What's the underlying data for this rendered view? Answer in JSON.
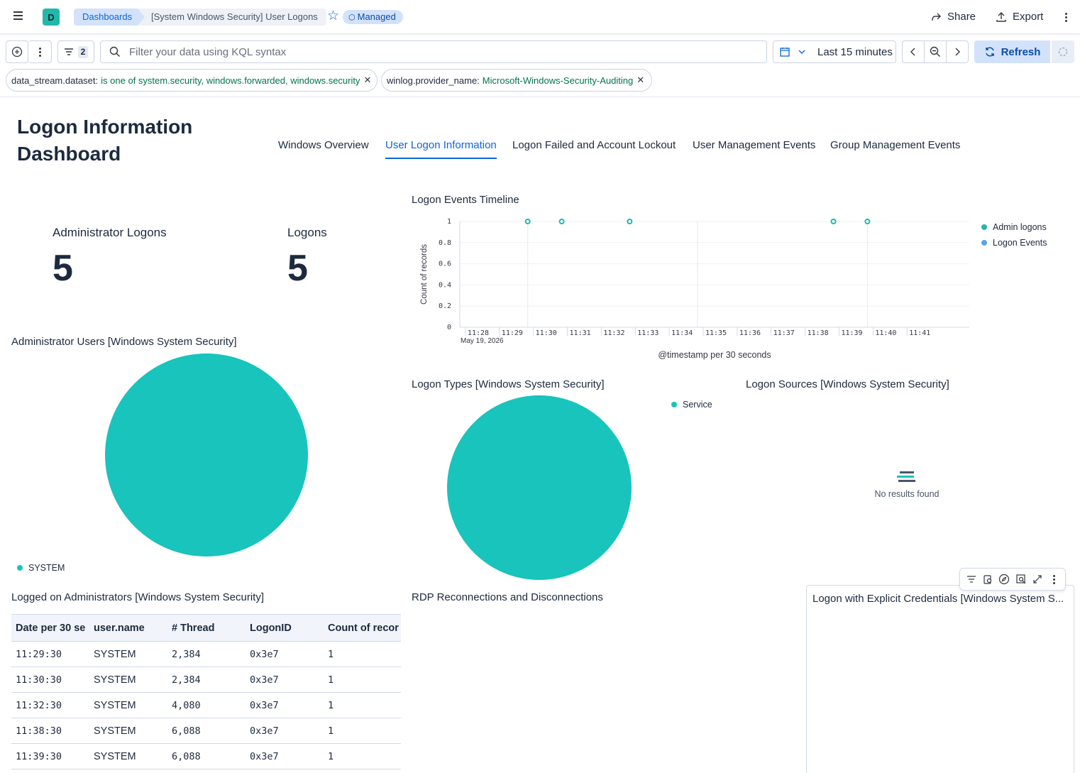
{
  "header": {
    "logo_letter": "D",
    "breadcrumb_root": "Dashboards",
    "breadcrumb_current": "[System Windows Security] User Logons",
    "managed_badge": "Managed",
    "share_label": "Share",
    "export_label": "Export"
  },
  "query_bar": {
    "filter_count": "2",
    "search_placeholder": "Filter your data using KQL syntax",
    "time_range": "Last 15 minutes",
    "refresh_label": "Refresh"
  },
  "filters": [
    {
      "field": "data_stream.dataset:",
      "value": "is one of system.security, windows.forwarded, windows.security"
    },
    {
      "field": "winlog.provider_name:",
      "value": "Microsoft-Windows-Security-Auditing"
    }
  ],
  "dashboard": {
    "title": "Logon Information Dashboard",
    "tabs": [
      {
        "label": "Windows Overview"
      },
      {
        "label": "User Logon Information"
      },
      {
        "label": "Logon Failed and Account Lockout"
      },
      {
        "label": "User Management Events"
      },
      {
        "label": "Group Management Events"
      }
    ],
    "active_tab": "User Logon Information"
  },
  "metrics": {
    "admin_logons": {
      "label": "Administrator Logons",
      "value": "5"
    },
    "logons": {
      "label": "Logons",
      "value": "5"
    }
  },
  "panels": {
    "timeline_title": "Logon Events Timeline",
    "admin_users_title": "Administrator Users [Windows System Security]",
    "logon_types_title": "Logon Types [Windows System Security]",
    "logon_sources_title": "Logon Sources [Windows System Security]",
    "logged_admins_title": "Logged on Administrators [Windows System Security]",
    "rdp_title": "RDP Reconnections and Disconnections",
    "explicit_creds_title": "Logon with Explicit Credentials [Windows System S...",
    "no_results": "No results found"
  },
  "chart_data": [
    {
      "type": "scatter",
      "title": "Logon Events Timeline",
      "xlabel": "@timestamp per 30 seconds",
      "ylabel": "Count of records",
      "x_sublabel": "May 19, 2026",
      "x_ticks": [
        "11:28",
        "11:29",
        "11:30",
        "11:31",
        "11:32",
        "11:33",
        "11:34",
        "11:35",
        "11:36",
        "11:37",
        "11:38",
        "11:39",
        "11:40",
        "11:41"
      ],
      "y_ticks": [
        "0",
        "0.2",
        "0.4",
        "0.6",
        "0.8",
        "1"
      ],
      "ylim": [
        0,
        1
      ],
      "series": [
        {
          "name": "Admin logons",
          "color": "#20b8ac",
          "x": [
            "11:29:30",
            "11:30:30",
            "11:32:30",
            "11:38:30",
            "11:39:30"
          ],
          "y": [
            1,
            1,
            1,
            1,
            1
          ]
        },
        {
          "name": "Logon Events",
          "color": "#5aa2f2",
          "x": [],
          "y": []
        }
      ],
      "legend_position": "right"
    },
    {
      "type": "pie",
      "title": "Administrator Users [Windows System Security]",
      "labels": [
        "SYSTEM"
      ],
      "values": [
        5
      ],
      "colors": [
        "#18c4bc"
      ]
    },
    {
      "type": "pie",
      "title": "Logon Types [Windows System Security]",
      "labels": [
        "Service"
      ],
      "values": [
        5
      ],
      "colors": [
        "#18c4bc"
      ]
    }
  ],
  "table": {
    "columns": [
      "Date per 30 se",
      "user.name",
      "# Thread",
      "LogonID",
      "Count of recor"
    ],
    "rows": [
      [
        "11:29:30",
        "SYSTEM",
        "2,384",
        "0x3e7",
        "1"
      ],
      [
        "11:30:30",
        "SYSTEM",
        "2,384",
        "0x3e7",
        "1"
      ],
      [
        "11:32:30",
        "SYSTEM",
        "4,080",
        "0x3e7",
        "1"
      ],
      [
        "11:38:30",
        "SYSTEM",
        "6,088",
        "0x3e7",
        "1"
      ],
      [
        "11:39:30",
        "SYSTEM",
        "6,088",
        "0x3e7",
        "1"
      ]
    ]
  },
  "colors": {
    "accent": "#0b64dd",
    "teal": "#18c4bc",
    "filter_value": "#00754f"
  }
}
